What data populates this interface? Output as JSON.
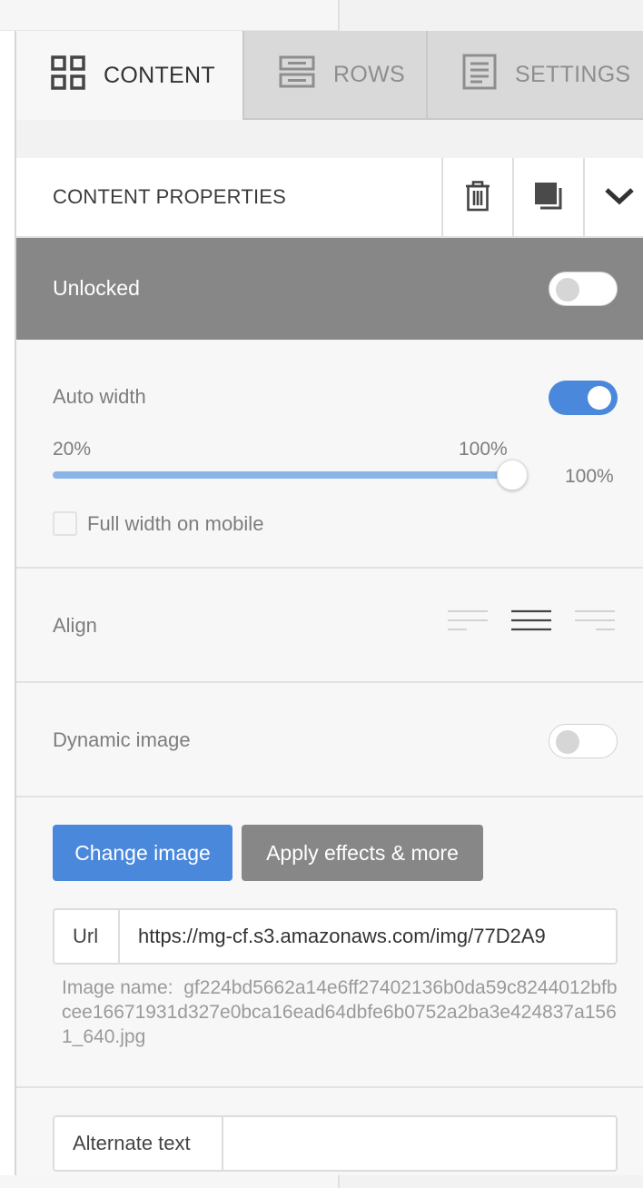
{
  "tabs": {
    "content": {
      "label": "CONTENT",
      "icon": "grid-icon"
    },
    "rows": {
      "label": "ROWS",
      "icon": "rows-icon"
    },
    "settings": {
      "label": "SETTINGS",
      "icon": "settings-doc-icon"
    }
  },
  "header": {
    "title": "CONTENT PROPERTIES",
    "icons": [
      "trash-icon",
      "duplicate-icon",
      "chevron-down-icon"
    ]
  },
  "lock": {
    "label": "Unlocked",
    "enabled": false
  },
  "auto_width": {
    "label": "Auto width",
    "enabled": true,
    "min_label": "20%",
    "max_label": "100%",
    "value": 100,
    "value_label": "100%"
  },
  "full_width_mobile": {
    "label": "Full width on mobile",
    "checked": false
  },
  "align": {
    "label": "Align",
    "selected": "center",
    "options": [
      "left",
      "center",
      "right"
    ]
  },
  "dynamic_image": {
    "label": "Dynamic image",
    "enabled": false
  },
  "buttons": {
    "change_image": "Change image",
    "apply_effects": "Apply effects & more"
  },
  "url": {
    "prefix": "Url",
    "value": "https://mg-cf.s3.amazonaws.com/img/77D2A9"
  },
  "image_name": {
    "label": "Image name:",
    "value": "gf224bd5662a14e6ff27402136b0da59c8244012bfbcee16671931d327e0bca16ead64dbfe6b0752a2ba3e424837a1561_640.jpg"
  },
  "alt_text": {
    "prefix": "Alternate text",
    "value": ""
  },
  "colors": {
    "accent": "#4a88dc",
    "lock_bar": "#878787",
    "panel_bg": "#f7f7f7"
  }
}
